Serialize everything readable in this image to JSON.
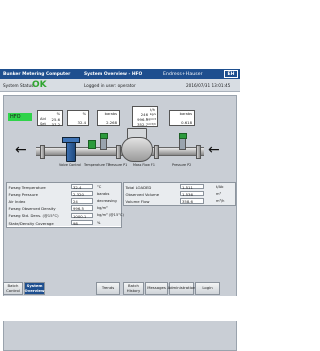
{
  "header": {
    "app_title": "Bunker Metering Computer",
    "view_title": "System Overview - HFO",
    "brand": "Endress+Hauser",
    "logo_text": "EH"
  },
  "statusbar": {
    "label": "System Status:",
    "status": "OK",
    "login_text": "Logged in user: operator",
    "datetime": "2016/07/31 13:01:45"
  },
  "diagram": {
    "fuel_tag": "HFO",
    "box1": {
      "unit": "%",
      "rows": [
        {
          "label": "Aid",
          "value": "25.6"
        },
        {
          "label": "Set",
          "value": "37.2"
        }
      ]
    },
    "box2": {
      "unit": "%",
      "value": "32.4"
    },
    "box3": {
      "unit": "barabs",
      "value": "2.268"
    },
    "box4": {
      "unit": "t/h",
      "rows": [
        {
          "value": "246",
          "unit": "kg/s"
        },
        {
          "value": "996.5",
          "unit": "kg/m3"
        },
        {
          "value": "352.7",
          "unit": "m3/h"
        }
      ]
    },
    "box5": {
      "unit": "barabs",
      "value": "0.618"
    },
    "labels": {
      "valve": "Valve Control",
      "temp": "Temperature T1",
      "press1": "Pressure P1",
      "massflow": "Mass Flow F1",
      "press2": "Pressure P2"
    }
  },
  "left_table": {
    "rows": [
      {
        "label": "Fwseg Temperature",
        "value": "32.4",
        "unit": "°C"
      },
      {
        "label": "Fwseg Pressure",
        "value": "2.320",
        "unit": "barabs"
      },
      {
        "label": "Air Index",
        "value": "24",
        "unit": "decreasing"
      },
      {
        "label": "Fwseg Observed Density",
        "value": "996.5",
        "unit": "kg/m³"
      },
      {
        "label": "Fwseg Std. Dens. (@15°C)",
        "value": "1000.1",
        "unit": "kg/m³ (@15°C)"
      },
      {
        "label": "State/Density Coverage",
        "value": "98",
        "unit": "%"
      }
    ]
  },
  "right_table": {
    "rows": [
      {
        "label": "Total LOADED",
        "value": "1.511",
        "unit": "t/Ab"
      },
      {
        "label": "Observed Volume",
        "value": "1.536",
        "unit": "m³"
      },
      {
        "label": "Volume Flow",
        "value": "358.6",
        "unit": "m³/h"
      }
    ]
  },
  "nav": {
    "buttons": [
      {
        "label": "Batch Control",
        "active": false
      },
      {
        "label": "System Overview",
        "active": true
      },
      {
        "label": "Trends",
        "active": false
      },
      {
        "label": "Batch History",
        "active": false
      },
      {
        "label": "Messages",
        "active": false
      },
      {
        "label": "Administration",
        "active": false
      },
      {
        "label": "Login",
        "active": false
      }
    ]
  }
}
